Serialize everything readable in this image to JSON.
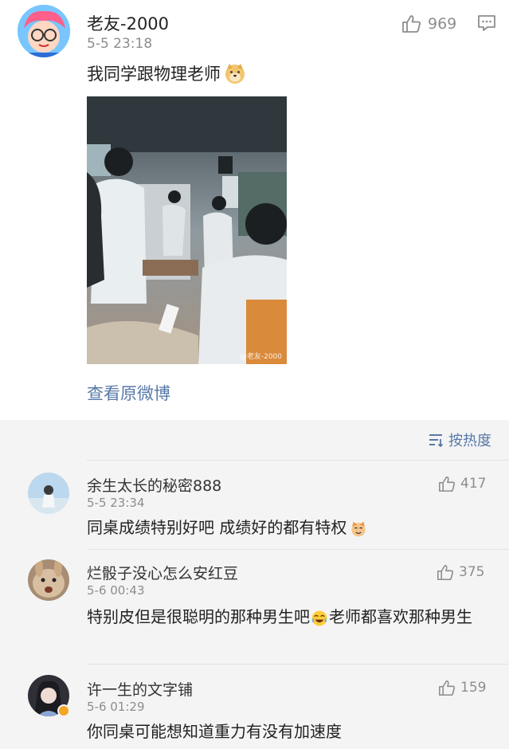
{
  "post": {
    "username": "老友-2000",
    "time": "5-5 23:18",
    "likes": "969",
    "text": "我同学跟物理老师",
    "text_emoji_icon": "doge-icon",
    "photo_watermark": "@老友-2000",
    "view_original": "查看原微博"
  },
  "sort": {
    "label": "按热度",
    "icon": "sort-lines-icon"
  },
  "comments": [
    {
      "username": "余生太长的秘密888",
      "time": "5-5 23:34",
      "likes": "417",
      "text": "同桌成绩特别好吧 成绩好的都有特权",
      "emoji_icon": "cat-emoji-icon"
    },
    {
      "username": "烂骰子没心怎么安红豆",
      "time": "5-6 00:43",
      "likes": "375",
      "text_part1": "特别皮但是很聪明的那种男生吧",
      "emoji_icon": "laugh-cry-emoji-icon",
      "text_part2": "老师都喜欢那种男生"
    },
    {
      "username": "许一生的文字铺",
      "time": "5-6 01:29",
      "likes": "159",
      "text": "你同桌可能想知道重力有没有加速度",
      "badge": "verified-badge-icon"
    }
  ],
  "colors": {
    "link": "#5779a8",
    "meta": "#8d8d8d",
    "comment_bg": "#f4f4f4"
  }
}
